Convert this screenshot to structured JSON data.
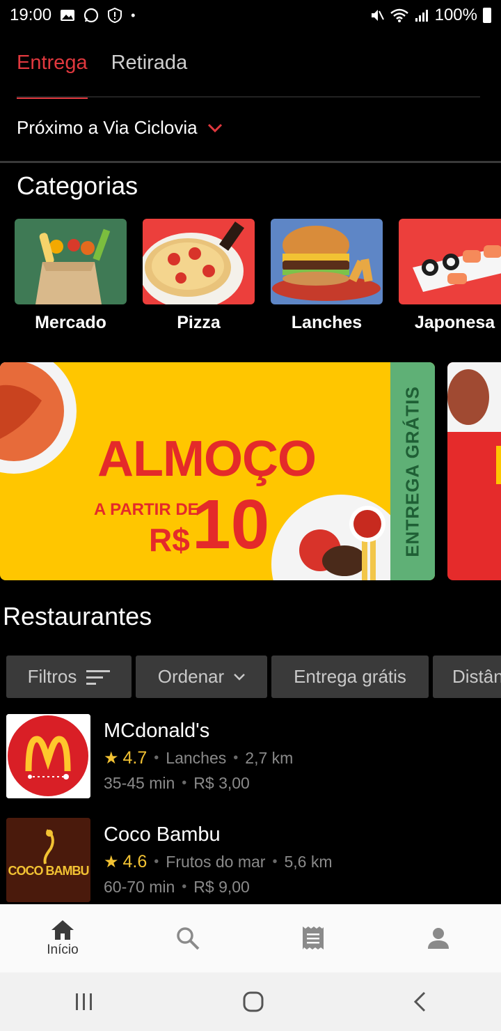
{
  "status": {
    "time": "19:00",
    "battery": "100%"
  },
  "tabs": [
    {
      "label": "Entrega",
      "active": true
    },
    {
      "label": "Retirada",
      "active": false
    }
  ],
  "address": "Próximo a Via Ciclovia",
  "categories_title": "Categorias",
  "categories": [
    {
      "label": "Mercado"
    },
    {
      "label": "Pizza"
    },
    {
      "label": "Lanches"
    },
    {
      "label": "Japonesa"
    }
  ],
  "banner": {
    "title": "ALMOÇO",
    "subtitle": "A PARTIR DE",
    "currency": "R$",
    "price": "10",
    "side_text": "ENTREGA GRÁTIS"
  },
  "restaurants_title": "Restaurantes",
  "filters": [
    {
      "label": "Filtros"
    },
    {
      "label": "Ordenar"
    },
    {
      "label": "Entrega grátis"
    },
    {
      "label": "Distân"
    }
  ],
  "restaurants": [
    {
      "name": "MCdonald's",
      "rating": "4.7",
      "category": "Lanches",
      "distance": "2,7 km",
      "time": "35-45 min",
      "fee": "R$ 3,00"
    },
    {
      "name": "Coco Bambu",
      "rating": "4.6",
      "category": "Frutos do mar",
      "distance": "5,6 km",
      "time": "60-70 min",
      "fee": "R$ 9,00",
      "logo_text": "COCO BAMBU"
    }
  ],
  "nav": {
    "home_label": "Início"
  },
  "colors": {
    "accent": "#e0383e",
    "banner_yellow": "#ffc600",
    "banner_green": "#5fb076",
    "star": "#f2c233"
  }
}
